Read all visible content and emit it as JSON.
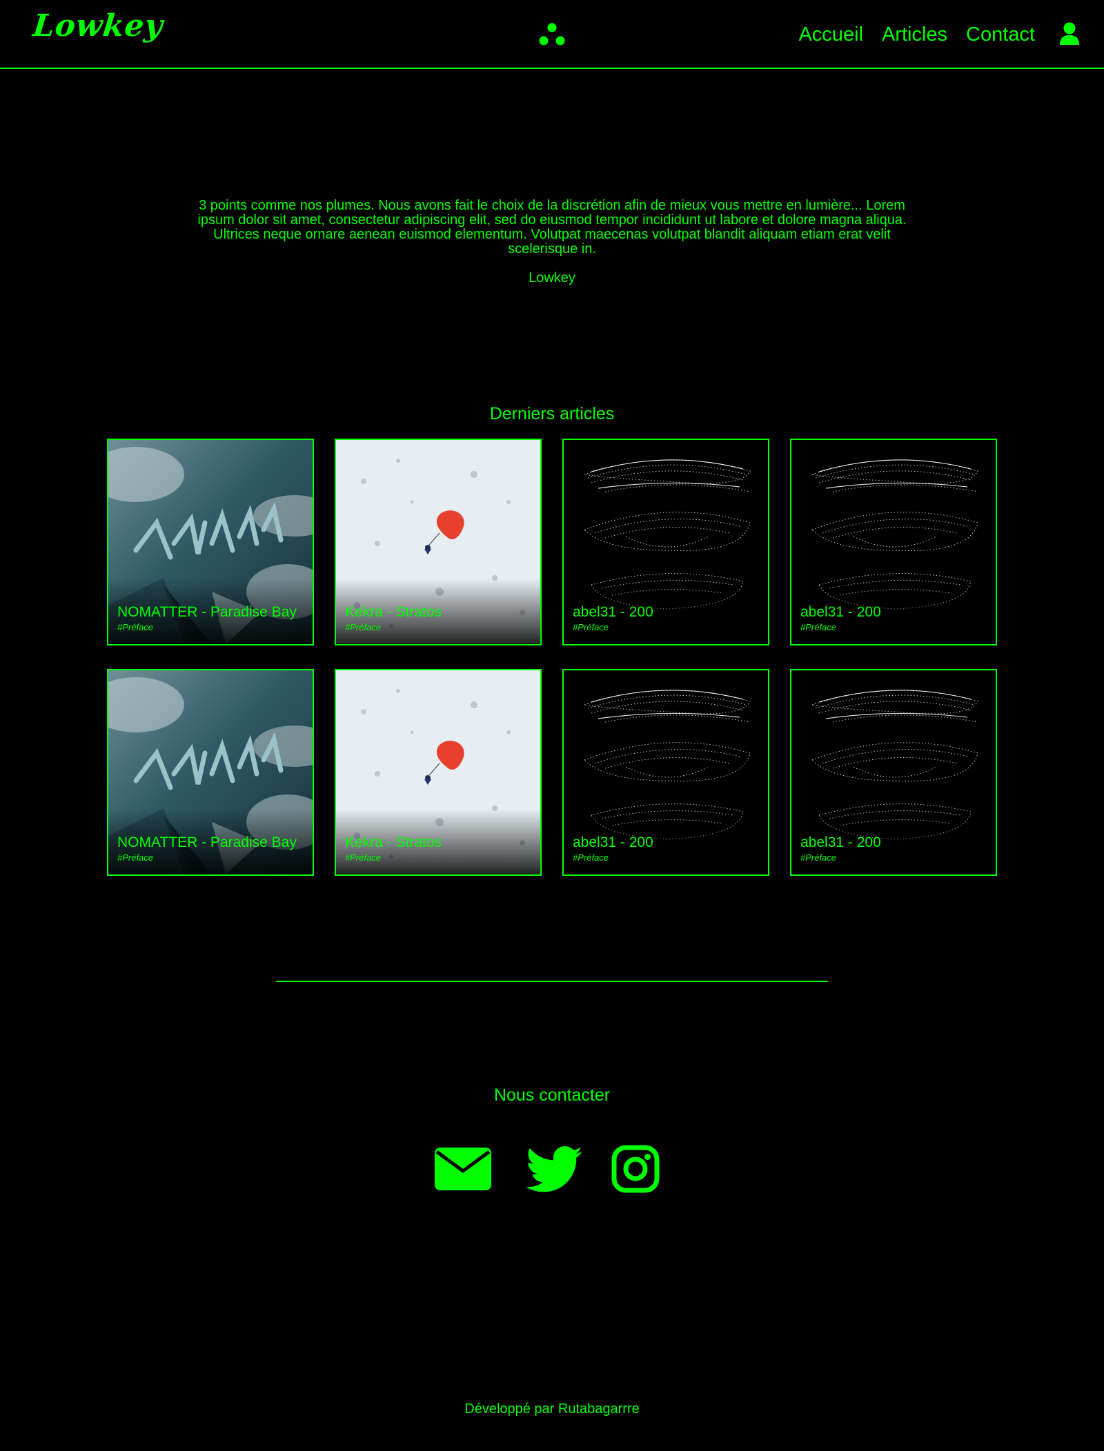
{
  "header": {
    "logo": "Lowkey",
    "nav": [
      "Accueil",
      "Articles",
      "Contact"
    ]
  },
  "intro": {
    "text": "3 points comme nos plumes. Nous avons fait le choix de la discrétion afin de mieux vous mettre en lumière... Lorem ipsum dolor sit amet, consectetur adipiscing elit, sed do eiusmod tempor incididunt ut labore et dolore magna aliqua. Ultrices neque ornare aenean euismod elementum. Volutpat maecenas volutpat blandit aliquam etiam erat velit scelerisque in.",
    "signature": "Lowkey"
  },
  "articles": {
    "title": "Derniers articles",
    "items": [
      {
        "title": "NOMATTER - Paradise Bay",
        "tag": "#Préface",
        "art": "paradise"
      },
      {
        "title": "Kekra - Stratos",
        "tag": "#Préface",
        "art": "stratos"
      },
      {
        "title": "abel31 - 200",
        "tag": "#Préface",
        "art": "wireframe"
      },
      {
        "title": "abel31 - 200",
        "tag": "#Préface",
        "art": "wireframe"
      },
      {
        "title": "NOMATTER - Paradise Bay",
        "tag": "#Préface",
        "art": "paradise"
      },
      {
        "title": "Kekra - Stratos",
        "tag": "#Préface",
        "art": "stratos"
      },
      {
        "title": "abel31 - 200",
        "tag": "#Préface",
        "art": "wireframe"
      },
      {
        "title": "abel31 - 200",
        "tag": "#Préface",
        "art": "wireframe"
      }
    ]
  },
  "contact": {
    "title": "Nous contacter",
    "icons": [
      "envelope-icon",
      "twitter-icon",
      "instagram-icon"
    ]
  },
  "footer": {
    "text": "Développé par Rutabagarrre"
  },
  "colors": {
    "accent": "#00ff00",
    "background": "#000000"
  }
}
